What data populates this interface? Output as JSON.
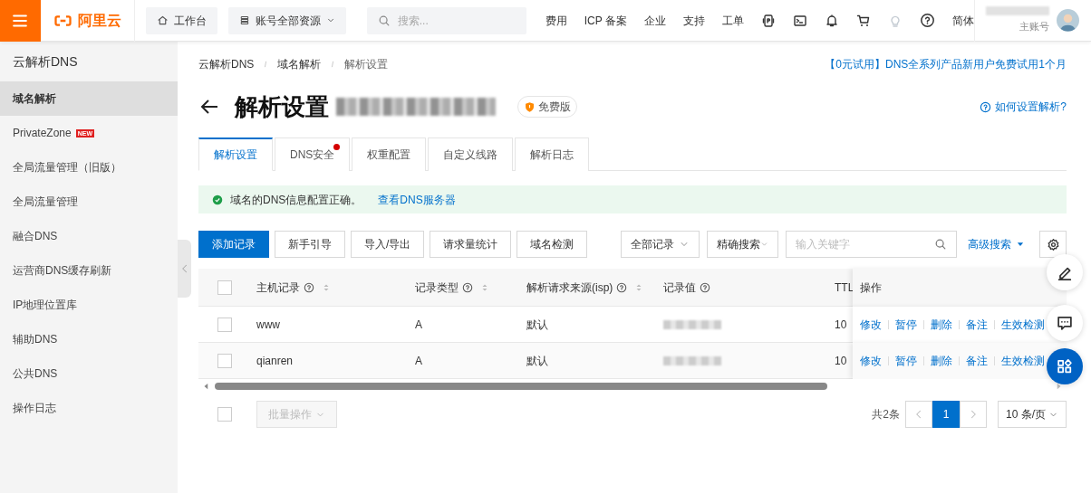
{
  "topbar": {
    "logo": "阿里云",
    "workbench": "工作台",
    "resource": "账号全部资源",
    "search_placeholder": "搜索...",
    "links": [
      "费用",
      "ICP 备案",
      "企业",
      "支持",
      "工单"
    ],
    "language": "简体",
    "account_role": "主账号"
  },
  "sidebar": {
    "title": "云解析DNS",
    "items": [
      {
        "label": "域名解析",
        "selected": true
      },
      {
        "label": "PrivateZone",
        "selected": false,
        "badge": "NEW"
      },
      {
        "label": "全局流量管理（旧版）",
        "selected": false
      },
      {
        "label": "全局流量管理",
        "selected": false
      },
      {
        "label": "融合DNS",
        "selected": false
      },
      {
        "label": "运营商DNS缓存刷新",
        "selected": false
      },
      {
        "label": "IP地理位置库",
        "selected": false
      },
      {
        "label": "辅助DNS",
        "selected": false
      },
      {
        "label": "公共DNS",
        "selected": false
      },
      {
        "label": "操作日志",
        "selected": false
      }
    ]
  },
  "breadcrumb": [
    "云解析DNS",
    "域名解析",
    "解析设置"
  ],
  "promo": "【0元试用】DNS全系列产品新用户免费试用1个月",
  "title": "解析设置",
  "edition": "免费版",
  "help_link": "如何设置解析?",
  "tabs": [
    {
      "label": "解析设置",
      "selected": true,
      "dot": false
    },
    {
      "label": "DNS安全",
      "selected": false,
      "dot": true
    },
    {
      "label": "权重配置",
      "selected": false,
      "dot": false
    },
    {
      "label": "自定义线路",
      "selected": false,
      "dot": false
    },
    {
      "label": "解析日志",
      "selected": false,
      "dot": false
    }
  ],
  "alert": {
    "message": "域名的DNS信息配置正确。",
    "link": "查看DNS服务器"
  },
  "actions": [
    {
      "label": "添加记录",
      "primary": true
    },
    {
      "label": "新手引导",
      "primary": false
    },
    {
      "label": "导入/导出",
      "primary": false
    },
    {
      "label": "请求量统计",
      "primary": false
    },
    {
      "label": "域名检测",
      "primary": false
    }
  ],
  "filters": {
    "record_filter": "全部记录",
    "search_mode": "精确搜索",
    "keyword_placeholder": "输入关键字",
    "advanced": "高级搜索"
  },
  "table": {
    "select_all_checked": false,
    "columns": [
      {
        "label": "主机记录",
        "help": true,
        "sortable": true
      },
      {
        "label": "记录类型",
        "help": true,
        "sortable": true
      },
      {
        "label": "解析请求来源(isp)",
        "help": true,
        "sortable": true
      },
      {
        "label": "记录值",
        "help": true,
        "sortable": false
      },
      {
        "label": "TTL",
        "help": false,
        "sortable": false
      },
      {
        "label": "操作",
        "help": false,
        "sortable": false
      }
    ],
    "rows": [
      {
        "checked": false,
        "host": "www",
        "type": "A",
        "isp": "默认",
        "ttl": "10",
        "actions": [
          "修改",
          "暂停",
          "删除",
          "备注",
          "生效检测"
        ]
      },
      {
        "checked": false,
        "host": "qianren",
        "type": "A",
        "isp": "默认",
        "ttl": "10",
        "actions": [
          "修改",
          "暂停",
          "删除",
          "备注",
          "生效检测"
        ]
      }
    ]
  },
  "footer": {
    "select_all_checked": false,
    "batch": "批量操作",
    "total": "共2条",
    "pages": [
      {
        "label": "1",
        "selected": true
      }
    ],
    "page_size": "10 条/页"
  }
}
